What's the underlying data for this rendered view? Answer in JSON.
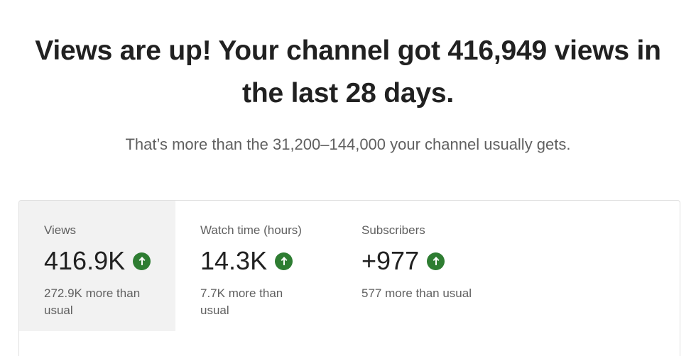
{
  "headline": "Views are up! Your channel got 416,949 views in the last 28 days.",
  "subline": "That’s more than the 31,200–144,000 your channel usually gets.",
  "metrics": [
    {
      "label": "Views",
      "value": "416.9K",
      "compare": "272.9K more than usual",
      "trend_icon": "arrow-up-icon",
      "selected": true
    },
    {
      "label": "Watch time (hours)",
      "value": "14.3K",
      "compare": "7.7K more than usual",
      "trend_icon": "arrow-up-icon",
      "selected": false
    },
    {
      "label": "Subscribers",
      "value": "+977",
      "compare": "577 more than usual",
      "trend_icon": "arrow-up-icon",
      "selected": false
    }
  ],
  "colors": {
    "trend_up": "#2e7d32",
    "selected_bg": "#f2f2f2",
    "text_primary": "#212121",
    "text_secondary": "#606060"
  }
}
